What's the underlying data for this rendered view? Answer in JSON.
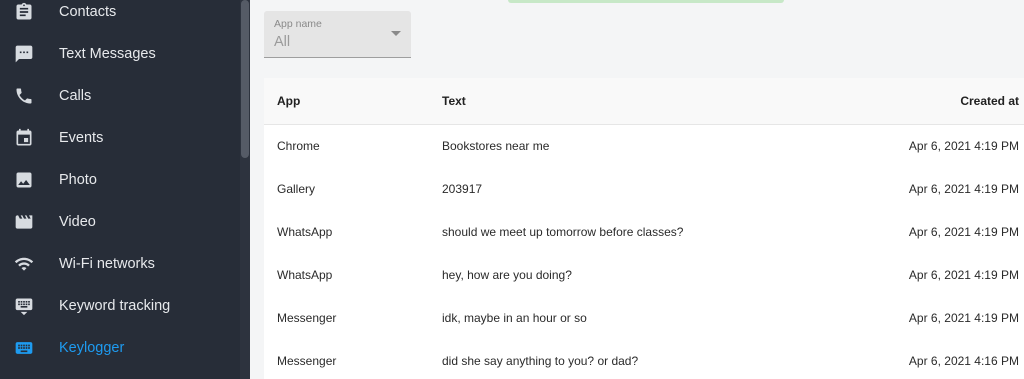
{
  "sidebar": {
    "items": [
      {
        "label": "Contacts",
        "icon": "contacts-clipboard-icon"
      },
      {
        "label": "Text Messages",
        "icon": "message-icon"
      },
      {
        "label": "Calls",
        "icon": "phone-icon"
      },
      {
        "label": "Events",
        "icon": "calendar-icon"
      },
      {
        "label": "Photo",
        "icon": "photo-icon"
      },
      {
        "label": "Video",
        "icon": "video-icon"
      },
      {
        "label": "Wi-Fi networks",
        "icon": "wifi-icon"
      },
      {
        "label": "Keyword tracking",
        "icon": "keyboard-icon"
      },
      {
        "label": "Keylogger",
        "icon": "keyboard-icon",
        "active": true
      }
    ]
  },
  "filter": {
    "label": "App name",
    "value": "All"
  },
  "table": {
    "columns": [
      "App",
      "Text",
      "Created at"
    ],
    "rows": [
      {
        "app": "Chrome",
        "text": "Bookstores near me",
        "created": "Apr 6, 2021 4:19 PM"
      },
      {
        "app": "Gallery",
        "text": "203917",
        "created": "Apr 6, 2021 4:19 PM"
      },
      {
        "app": "WhatsApp",
        "text": "should we meet up tomorrow before classes?",
        "created": "Apr 6, 2021 4:19 PM"
      },
      {
        "app": "WhatsApp",
        "text": "hey, how are you doing?",
        "created": "Apr 6, 2021 4:19 PM"
      },
      {
        "app": "Messenger",
        "text": "idk, maybe in an hour or so",
        "created": "Apr 6, 2021 4:19 PM"
      },
      {
        "app": "Messenger",
        "text": "did she say anything to you? or dad?",
        "created": "Apr 6, 2021 4:16 PM"
      }
    ]
  },
  "colors": {
    "sidebar_bg": "#272d38",
    "active_accent": "#1e9bf0"
  }
}
